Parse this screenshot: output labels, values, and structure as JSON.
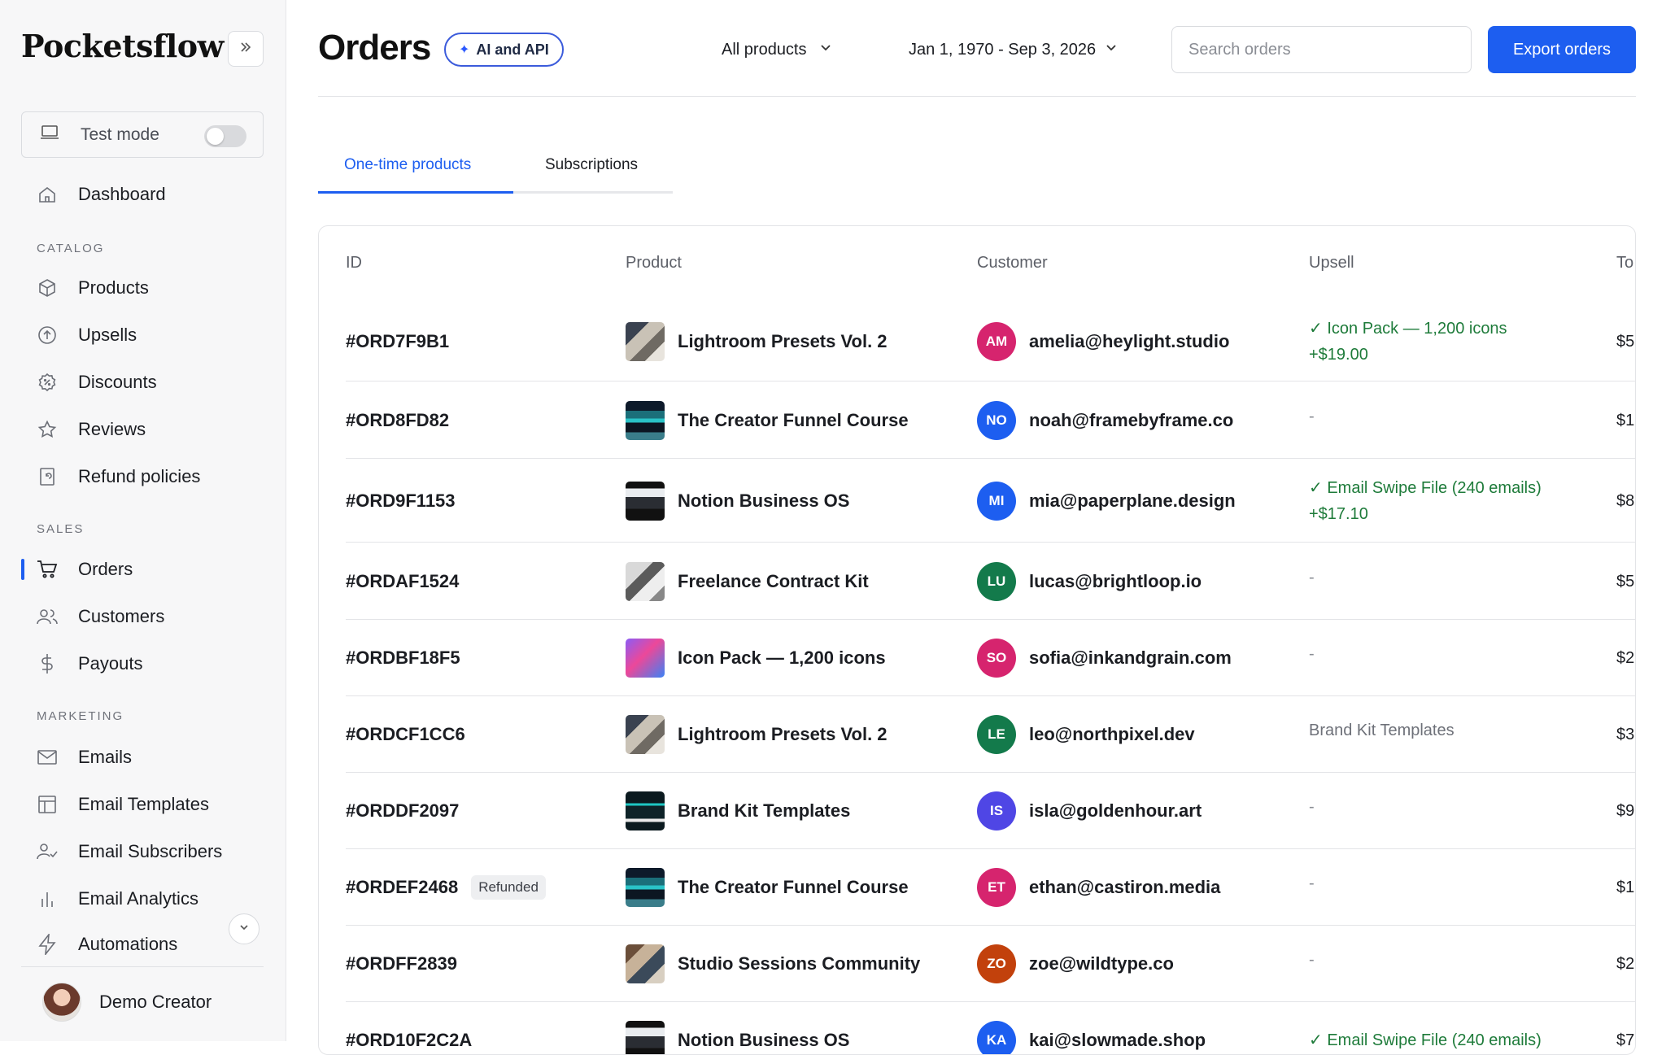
{
  "app": {
    "brand": "Pocketsflow"
  },
  "sidebar": {
    "test_mode_label": "Test mode",
    "dashboard": "Dashboard",
    "sections": {
      "catalog": "CATALOG",
      "sales": "SALES",
      "marketing": "MARKETING"
    },
    "catalog_items": [
      "Products",
      "Upsells",
      "Discounts",
      "Reviews",
      "Refund policies"
    ],
    "sales_items": [
      "Orders",
      "Customers",
      "Payouts"
    ],
    "marketing_items": [
      "Emails",
      "Email Templates",
      "Email Subscribers",
      "Email Analytics",
      "Automations"
    ],
    "user_name": "Demo Creator"
  },
  "header": {
    "title": "Orders",
    "ai_pill": "AI and API",
    "product_filter": "All products",
    "date_range": "Jan 1, 1970 - Sep 3, 2026",
    "search_placeholder": "Search orders",
    "export_label": "Export orders"
  },
  "tabs": [
    {
      "label": "One-time products",
      "active": true
    },
    {
      "label": "Subscriptions",
      "active": false
    }
  ],
  "table": {
    "columns": [
      "ID",
      "Product",
      "Customer",
      "Upsell",
      "To"
    ],
    "rows": [
      {
        "id": "#ORD7F9B1",
        "badge": "",
        "product": "Lightroom Presets Vol. 2",
        "thumb": "lightroom",
        "initials": "AM",
        "color": "#d6246e",
        "email": "amelia@heylight.studio",
        "upsell": "Icon Pack — 1,200 icons",
        "upsell_price": "+$19.00",
        "upsell_type": "ok",
        "total": "$5"
      },
      {
        "id": "#ORD8FD82",
        "badge": "",
        "product": "The Creator Funnel Course",
        "thumb": "funnel",
        "initials": "NO",
        "color": "#1d5ef0",
        "email": "noah@framebyframe.co",
        "upsell": "-",
        "upsell_price": "",
        "upsell_type": "dash",
        "total": "$1"
      },
      {
        "id": "#ORD9F1153",
        "badge": "",
        "product": "Notion Business OS",
        "thumb": "notion",
        "initials": "MI",
        "color": "#1d5ef0",
        "email": "mia@paperplane.design",
        "upsell": "Email Swipe File (240 emails)",
        "upsell_price": "+$17.10",
        "upsell_type": "ok",
        "total": "$8"
      },
      {
        "id": "#ORDAF1524",
        "badge": "",
        "product": "Freelance Contract Kit",
        "thumb": "freelance",
        "initials": "LU",
        "color": "#137a4b",
        "email": "lucas@brightloop.io",
        "upsell": "-",
        "upsell_price": "",
        "upsell_type": "dash",
        "total": "$5"
      },
      {
        "id": "#ORDBF18F5",
        "badge": "",
        "product": "Icon Pack — 1,200 icons",
        "thumb": "iconpack",
        "initials": "SO",
        "color": "#d6246e",
        "email": "sofia@inkandgrain.com",
        "upsell": "-",
        "upsell_price": "",
        "upsell_type": "dash",
        "total": "$2"
      },
      {
        "id": "#ORDCF1CC6",
        "badge": "",
        "product": "Lightroom Presets Vol. 2",
        "thumb": "lightroom",
        "initials": "LE",
        "color": "#137a4b",
        "email": "leo@northpixel.dev",
        "upsell": "Brand Kit Templates",
        "upsell_price": "",
        "upsell_type": "plain",
        "total": "$3"
      },
      {
        "id": "#ORDDF2097",
        "badge": "",
        "product": "Brand Kit Templates",
        "thumb": "brandkit",
        "initials": "IS",
        "color": "#4f46e5",
        "email": "isla@goldenhour.art",
        "upsell": "-",
        "upsell_price": "",
        "upsell_type": "dash",
        "total": "$9"
      },
      {
        "id": "#ORDEF2468",
        "badge": "Refunded",
        "product": "The Creator Funnel Course",
        "thumb": "funnel",
        "initials": "ET",
        "color": "#d6246e",
        "email": "ethan@castiron.media",
        "upsell": "-",
        "upsell_price": "",
        "upsell_type": "dash",
        "total": "$1"
      },
      {
        "id": "#ORDFF2839",
        "badge": "",
        "product": "Studio Sessions Community",
        "thumb": "studio",
        "initials": "ZO",
        "color": "#c2410c",
        "email": "zoe@wildtype.co",
        "upsell": "-",
        "upsell_price": "",
        "upsell_type": "dash",
        "total": "$2"
      },
      {
        "id": "#ORD10F2C2A",
        "badge": "",
        "product": "Notion Business OS",
        "thumb": "notion",
        "initials": "KA",
        "color": "#1d5ef0",
        "email": "kai@slowmade.shop",
        "upsell": "Email Swipe File (240 emails)",
        "upsell_price": "",
        "upsell_type": "ok",
        "total": "$7"
      }
    ]
  },
  "colors": {
    "accent": "#1d5ef0",
    "success": "#1e7b3a"
  }
}
